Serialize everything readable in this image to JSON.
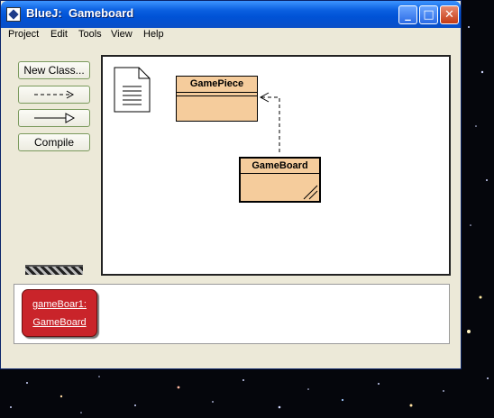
{
  "window": {
    "title": "BlueJ:  Gameboard",
    "minimize_label": "_",
    "maximize_label": "□",
    "close_label": "✕"
  },
  "menu": [
    "Project",
    "Edit",
    "Tools",
    "View",
    "Help"
  ],
  "toolbar": {
    "new_class": "New Class...",
    "uses_arrow": "- - ->",
    "inherits_arrow": "——▷",
    "compile": "Compile"
  },
  "diagram": {
    "classes": [
      {
        "name": "GamePiece"
      },
      {
        "name": "GameBoard"
      }
    ]
  },
  "object_bench": {
    "objects": [
      {
        "instance": "gameBoar1:",
        "type": "GameBoard"
      }
    ]
  },
  "colors": {
    "class_fill": "#f5cc9c",
    "object_fill": "#c9242a",
    "titlebar": "#0052d6"
  }
}
